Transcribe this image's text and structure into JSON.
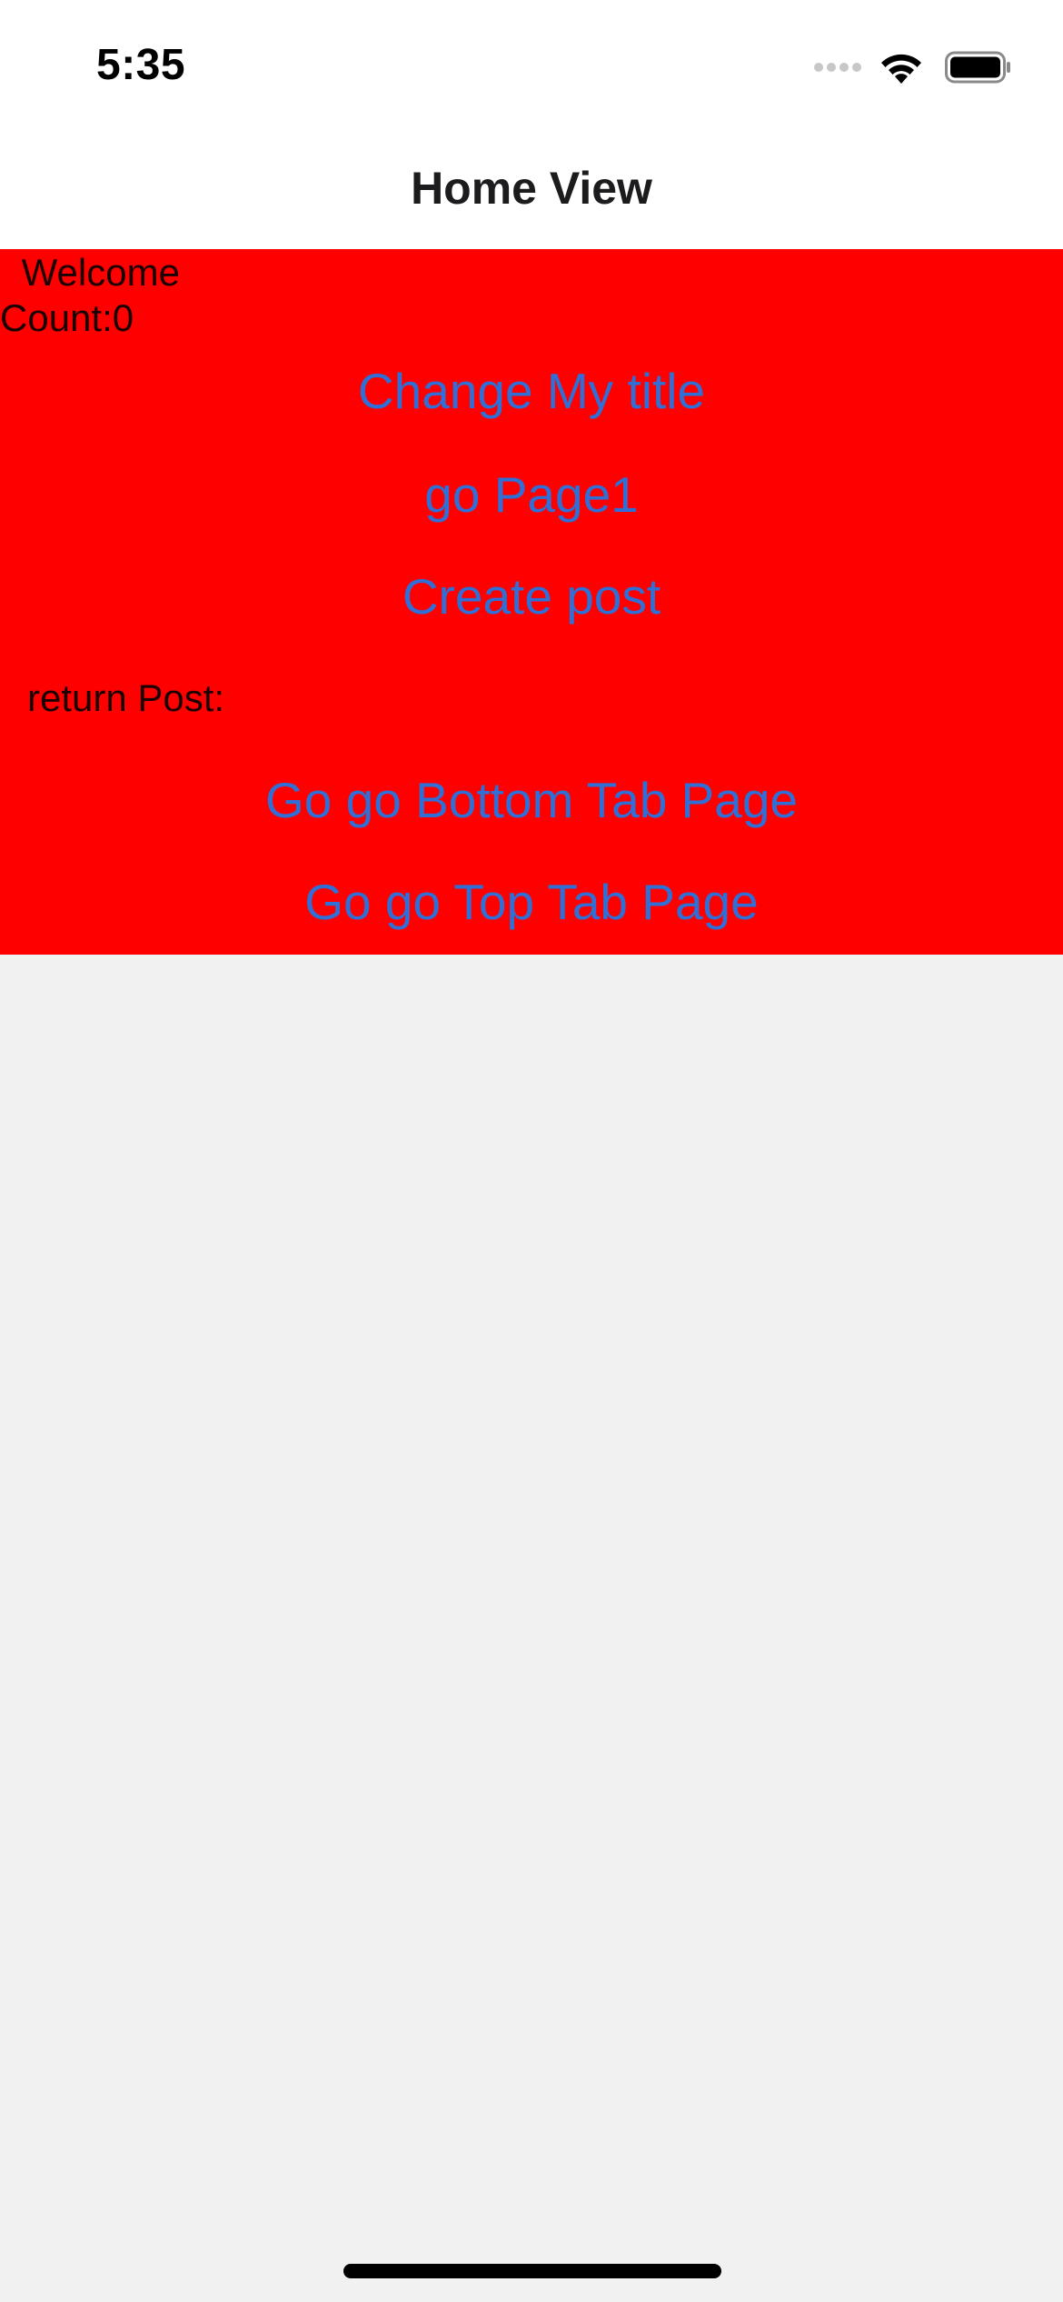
{
  "status_bar": {
    "time": "5:35",
    "icons": [
      "signal-dots-icon",
      "wifi-icon",
      "battery-icon"
    ]
  },
  "nav_bar": {
    "title": "Home View"
  },
  "content": {
    "background_color": "#ff0000",
    "welcome": " Welcome",
    "count": "Count:0",
    "buttons": {
      "change_title": "Change My title",
      "go_page1": "go Page1",
      "create_post": "Create post",
      "bottom_tab": "Go go Bottom Tab Page",
      "top_tab": "Go go Top Tab Page"
    },
    "return_post_label": "return Post:"
  },
  "colors": {
    "link": "#2f6fd6",
    "panel": "#ff0000",
    "page_background": "#f1f1f1"
  }
}
